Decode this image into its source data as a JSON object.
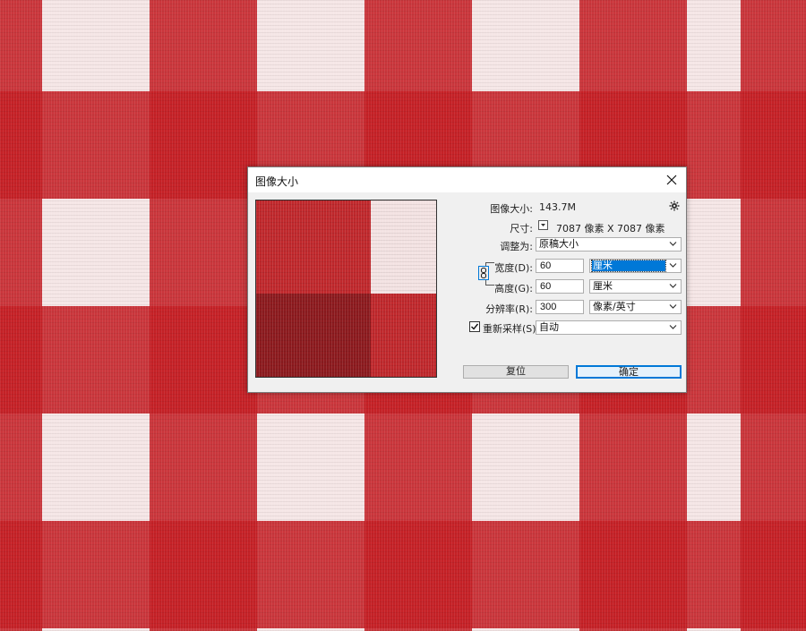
{
  "dialog": {
    "title": "图像大小",
    "size_label": "图像大小:",
    "size_value": "143.7M",
    "dimensions_label": "尺寸:",
    "dimensions_value": "7087 像素  X  7087 像素",
    "fit_label": "调整为:",
    "fit_value": "原稿大小",
    "width_label": "宽度(D):",
    "width_value": "60",
    "width_unit": "厘米",
    "height_label": "高度(G):",
    "height_value": "60",
    "height_unit": "厘米",
    "resolution_label": "分辨率(R):",
    "resolution_value": "300",
    "resolution_unit": "像素/英寸",
    "resample_label": "重新采样(S):",
    "resample_checked": true,
    "resample_value": "自动",
    "reset_label": "复位",
    "ok_label": "确定"
  },
  "colors": {
    "gingham_red": "#c41e24",
    "gingham_white": "#f5e6e6",
    "dialog_bg": "#f0f0f0",
    "selection_blue": "#0078d7",
    "button_border": "#0078d7"
  },
  "icons": [
    "close-icon",
    "gear-icon",
    "chevron-down-icon",
    "chain-link-icon",
    "checkmark-icon",
    "dropdown-toggle-icon"
  ]
}
